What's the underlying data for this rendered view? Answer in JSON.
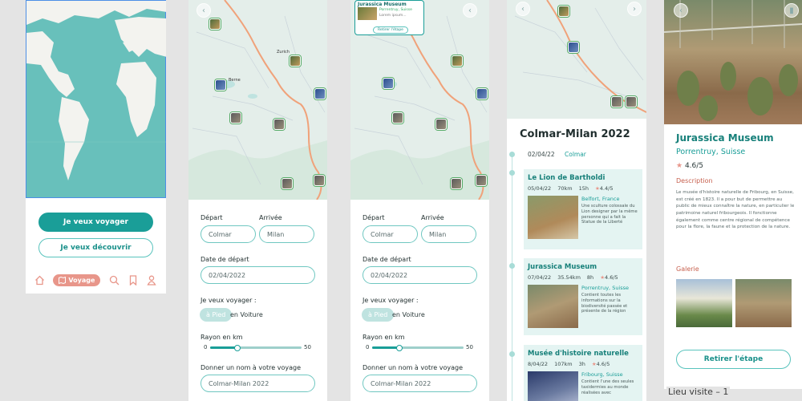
{
  "screen1": {
    "primary_button": "Je veux voyager",
    "secondary_button": "Je veux découvrir",
    "nav": {
      "active": "Voyage",
      "icons": [
        "home-icon",
        "map-icon",
        "search-icon",
        "bookmark-icon",
        "user-icon"
      ]
    }
  },
  "form": {
    "depart_label": "Départ",
    "arrivee_label": "Arrivée",
    "depart_value": "Colmar",
    "arrivee_value": "Milan",
    "date_label": "Date de départ",
    "date_value": "02/04/2022",
    "mode_label": "Je veux voyager :",
    "mode_pied": "à Pied",
    "mode_voiture": "en Voiture",
    "rayon_label": "Rayon en km",
    "rayon_min": "0",
    "rayon_max": "50",
    "rayon_fraction": 0.3,
    "name_label": "Donner un nom à votre voyage",
    "name_value": "Colmar-Milan 2022"
  },
  "popup": {
    "title": "Jurassica Museum",
    "line1": "Porrentruy, Suisse",
    "line2": "Lorem ipsum...",
    "button": "Retirer l'étape"
  },
  "trip": {
    "title": "Colmar-Milan 2022",
    "start_date": "02/04/22",
    "start_city": "Colmar",
    "stops": [
      {
        "name": "Le Lion de Bartholdi",
        "date": "05/04/22",
        "dist": "70km",
        "dur": "15h",
        "rating": "4.4/5",
        "loc": "Belfort, France",
        "desc": "Une sculture colossale du Lion designer par la même personne qui a fait la Statue de la Liberté"
      },
      {
        "name": "Jurassica Museum",
        "date": "07/04/22",
        "dist": "35.54km",
        "dur": "8h",
        "rating": "4.6/5",
        "loc": "Porrentruy, Suisse",
        "desc": "Contient toutes les informations sur la biodiversité passée et présente de la région"
      },
      {
        "name": "Musée d'histoire naturelle",
        "date": "8/04/22",
        "dist": "107km",
        "dur": "3h",
        "rating": "4.6/5",
        "loc": "Fribourg, Suisse",
        "desc": "Contient l'une des seules taxidermies au monde réalisées avec"
      }
    ]
  },
  "museum": {
    "title": "Jurassica Museum",
    "subtitle": "Porrentruy, Suisse",
    "rating": "4.6/5",
    "description_label": "Description",
    "description": "Le musée d'histoire naturelle de Fribourg, en Suisse, est créé en 1823. Il a pour but de permettre au public de mieux connaître la nature, en particulier le patrimoine naturel fribourgeois. Il fonctionne également comme centre régional de compétence pour la flore, la faune et la protection de la nature.",
    "gallery_label": "Galerie",
    "remove_button": "Retirer l'étape"
  },
  "map_labels": {
    "zurich": "Zurich",
    "berne": "Berne"
  },
  "caption": "Lieu visite – 1",
  "colors": {
    "teal": "#1a9e98",
    "coral": "#e8968a",
    "route": "#f0a27a"
  }
}
